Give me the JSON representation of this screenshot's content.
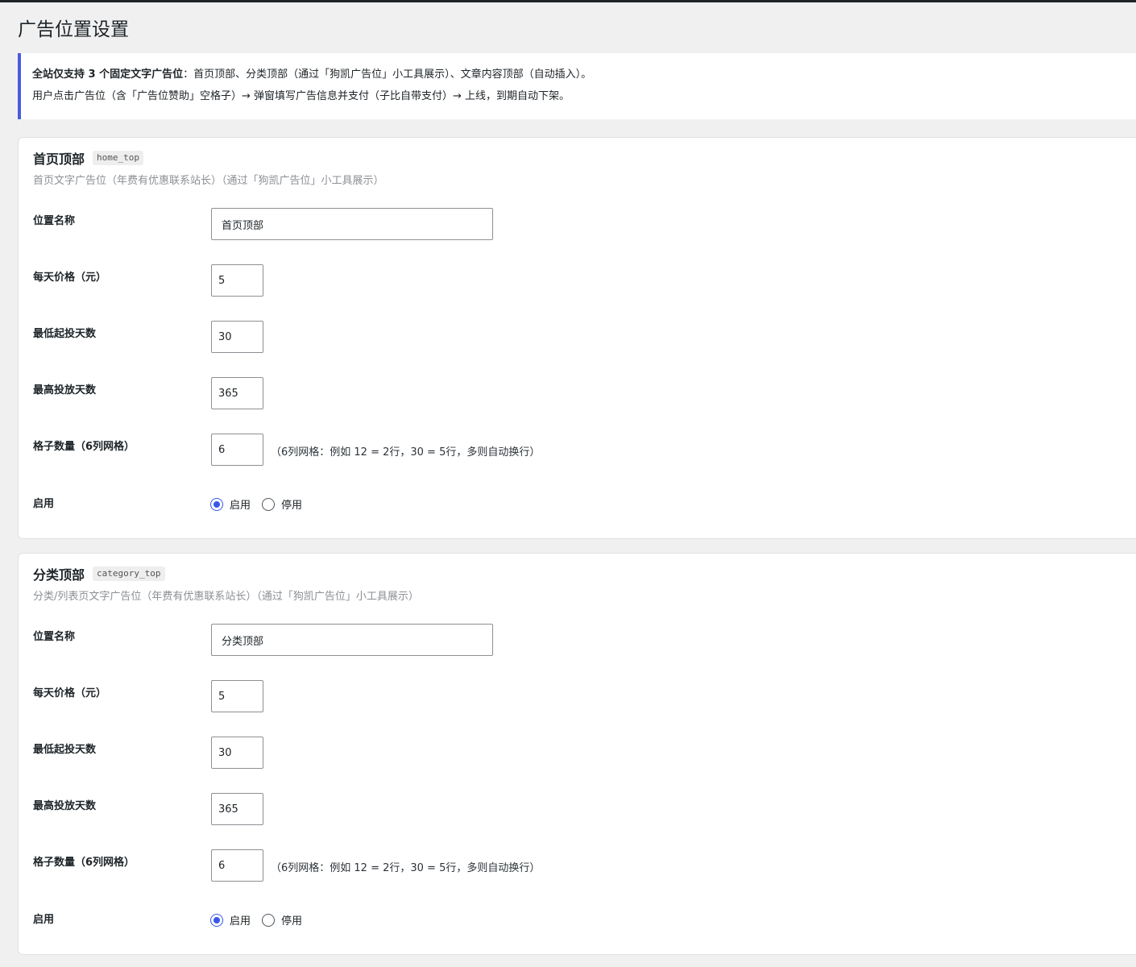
{
  "page": {
    "title": "广告位置设置"
  },
  "notice": {
    "line1_bold": "全站仅支持 3 个固定文字广告位",
    "line1_rest": "：首页顶部、分类顶部（通过「狗凯广告位」小工具展示）、文章内容顶部（自动插入）。",
    "line2": "用户点击广告位（含「广告位赞助」空格子）→ 弹窗填写广告信息并支付（子比自带支付）→ 上线，到期自动下架。"
  },
  "sections": [
    {
      "title": "首页顶部",
      "code": "home_top",
      "desc": "首页文字广告位（年费有优惠联系站长）（通过「狗凯广告位」小工具展示）",
      "fields": {
        "name_label": "位置名称",
        "name_value": "首页顶部",
        "price_label": "每天价格（元）",
        "price_value": "5",
        "min_label": "最低起投天数",
        "min_value": "30",
        "max_label": "最高投放天数",
        "max_value": "365",
        "grid_label": "格子数量（6列网格）",
        "grid_value": "6",
        "grid_hint": "（6列网格：例如 12 = 2行，30 = 5行，多则自动换行）",
        "enable_label": "启用",
        "enable_on": "启用",
        "enable_off": "停用",
        "enabled": true
      }
    },
    {
      "title": "分类顶部",
      "code": "category_top",
      "desc": "分类/列表页文字广告位（年费有优惠联系站长）（通过「狗凯广告位」小工具展示）",
      "fields": {
        "name_label": "位置名称",
        "name_value": "分类顶部",
        "price_label": "每天价格（元）",
        "price_value": "5",
        "min_label": "最低起投天数",
        "min_value": "30",
        "max_label": "最高投放天数",
        "max_value": "365",
        "grid_label": "格子数量（6列网格）",
        "grid_value": "6",
        "grid_hint": "（6列网格：例如 12 = 2行，30 = 5行，多则自动换行）",
        "enable_label": "启用",
        "enable_on": "启用",
        "enable_off": "停用",
        "enabled": true
      }
    }
  ],
  "colors": {
    "accent": "#3858e9",
    "notice_border": "#4a5bdc",
    "background": "#f0f0f1"
  }
}
